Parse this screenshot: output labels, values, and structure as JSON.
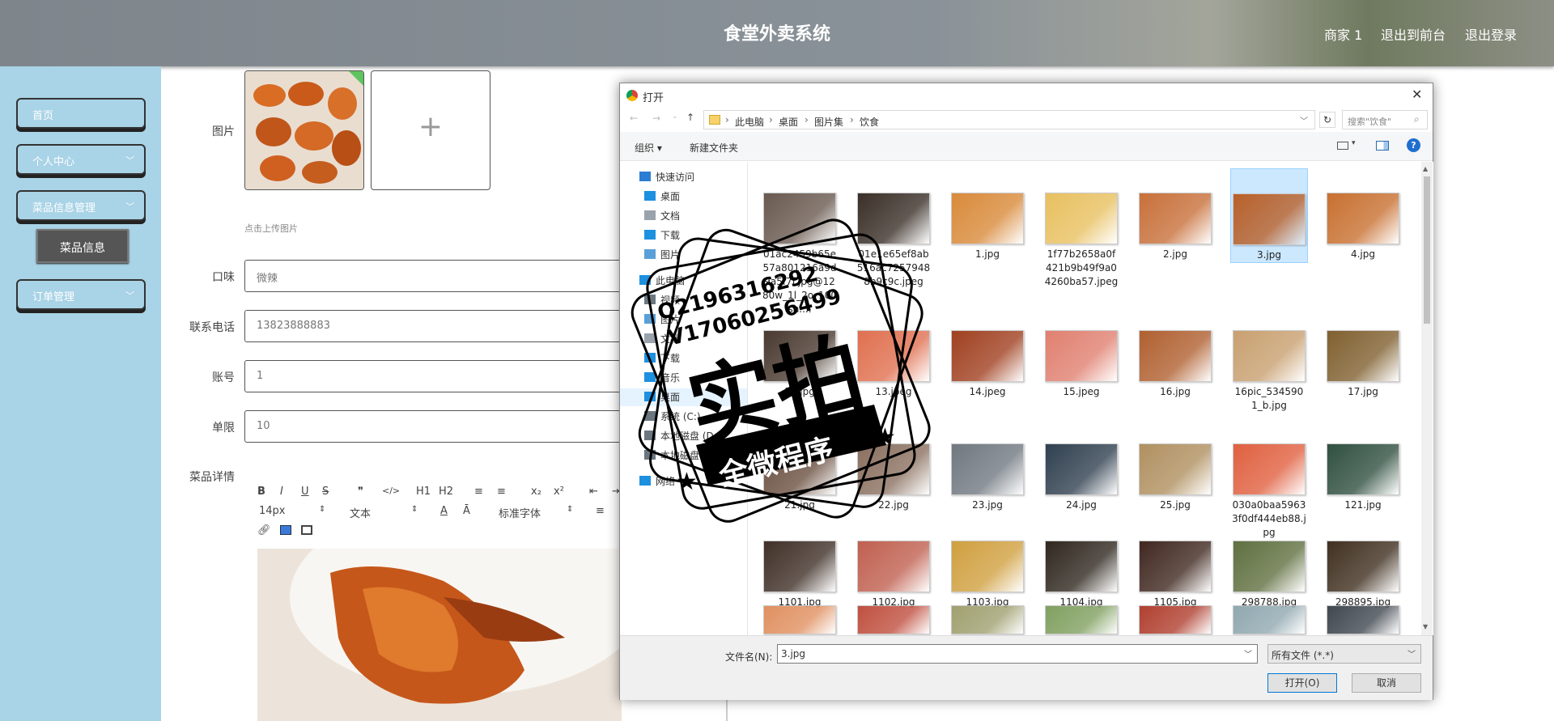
{
  "header": {
    "title": "食堂外卖系统",
    "nav": [
      "商家 1",
      "退出到前台",
      "退出登录"
    ]
  },
  "sidebar": {
    "items": [
      {
        "label": "首页"
      },
      {
        "label": "个人中心"
      },
      {
        "label": "菜品信息管理"
      },
      {
        "label": "订单管理"
      }
    ],
    "submenu": "菜品信息"
  },
  "form": {
    "image_label": "图片",
    "upload_hint": "点击上传图片",
    "plus": "+",
    "fields": [
      {
        "label": "口味",
        "value": "微辣"
      },
      {
        "label": "联系电话",
        "value": "13823888883"
      },
      {
        "label": "账号",
        "value": "1"
      },
      {
        "label": "单限",
        "value": "10"
      }
    ],
    "detail_label": "菜品详情",
    "editor": {
      "row1": [
        "B",
        "I",
        "U",
        "S",
        "❞",
        "</>",
        "H1",
        "H2",
        "≡",
        "≡",
        "x₂",
        "x²",
        "⇤",
        "⇥"
      ],
      "size": "14px",
      "kind": "文本",
      "font": "标准字体"
    }
  },
  "dialog": {
    "title": "打开",
    "close": "✕",
    "path": [
      "此电脑",
      "桌面",
      "图片集",
      "饮食"
    ],
    "search_placeholder": "搜索\"饮食\"",
    "organize": "组织 ▾",
    "new_folder": "新建文件夹",
    "help": "?",
    "nav": [
      {
        "label": "快速访问",
        "icon": "star-icon",
        "color": "#2b7cd3"
      },
      {
        "label": "桌面",
        "icon": "desktop-icon",
        "color": "#1e90e0"
      },
      {
        "label": "文档",
        "icon": "document-icon",
        "color": "#9aa3ab"
      },
      {
        "label": "下载",
        "icon": "download-icon",
        "color": "#1e90e0"
      },
      {
        "label": "图片",
        "icon": "pictures-icon",
        "color": "#5aa0d8"
      },
      {
        "label": "此电脑",
        "icon": "computer-icon",
        "color": "#1e90e0"
      },
      {
        "label": "视频",
        "icon": "video-icon",
        "color": "#6b7680"
      },
      {
        "label": "图片",
        "icon": "pictures-icon",
        "color": "#5aa0d8"
      },
      {
        "label": "文档",
        "icon": "document-icon",
        "color": "#9aa3ab"
      },
      {
        "label": "下载",
        "icon": "download-icon",
        "color": "#1e90e0"
      },
      {
        "label": "音乐",
        "icon": "music-icon",
        "color": "#1e90e0"
      },
      {
        "label": "桌面",
        "icon": "desktop-icon",
        "color": "#1e90e0"
      },
      {
        "label": "系统 (C:)",
        "icon": "drive-icon",
        "color": "#6b7680"
      },
      {
        "label": "本地磁盘 (D:)",
        "icon": "drive-icon",
        "color": "#6b7680"
      },
      {
        "label": "本地磁盘 (E:)",
        "icon": "drive-icon",
        "color": "#6b7680"
      },
      {
        "label": "网络",
        "icon": "network-icon",
        "color": "#1e90e0"
      }
    ],
    "files": [
      {
        "name": "01ac2459b65e57a801216a9d9a5f7f.jpg@1280w_1l_2o_100sh....",
        "color": "#6a5a50"
      },
      {
        "name": "01e1e65ef8ab516ac72579488b9c9c.jpeg",
        "color": "#3a2f28"
      },
      {
        "name": "1.jpg",
        "color": "#d98a3a"
      },
      {
        "name": "1f77b2658a0f421b9b49f9a04260ba57.jpeg",
        "color": "#e8c060"
      },
      {
        "name": "2.jpg",
        "color": "#c8703a"
      },
      {
        "name": "3.jpg",
        "color": "#b8602a"
      },
      {
        "name": "4.jpg",
        "color": "#c87030"
      },
      {
        "name": "12.jpg",
        "color": "#4a3a30"
      },
      {
        "name": "13.jpeg",
        "color": "#e07050"
      },
      {
        "name": "14.jpeg",
        "color": "#a04020"
      },
      {
        "name": "15.jpeg",
        "color": "#e08070"
      },
      {
        "name": "16.jpg",
        "color": "#b06030"
      },
      {
        "name": "16pic_5345901_b.jpg",
        "color": "#c8a070"
      },
      {
        "name": "17.jpg",
        "color": "#806030"
      },
      {
        "name": "21.jpg",
        "color": "#6a5040"
      },
      {
        "name": "22.jpg",
        "color": "#8a7060"
      },
      {
        "name": "23.jpg",
        "color": "#707880"
      },
      {
        "name": "24.jpg",
        "color": "#304050"
      },
      {
        "name": "25.jpg",
        "color": "#b09060"
      },
      {
        "name": "030a0baa59633f0df444eb88.jpg",
        "color": "#e06040"
      },
      {
        "name": "121.jpg",
        "color": "#305040"
      },
      {
        "name": "1101.jpg",
        "color": "#403028"
      },
      {
        "name": "1102.jpg",
        "color": "#c06050"
      },
      {
        "name": "1103.jpg",
        "color": "#d0a040"
      },
      {
        "name": "1104.jpg",
        "color": "#302820"
      },
      {
        "name": "1105.jpg",
        "color": "#402820"
      },
      {
        "name": "298788.jpg",
        "color": "#607040"
      },
      {
        "name": "298895.jpg",
        "color": "#403020"
      },
      {
        "name": "",
        "color": "#e09060"
      },
      {
        "name": "",
        "color": "#c05040"
      },
      {
        "name": "",
        "color": "#a0a070"
      },
      {
        "name": "",
        "color": "#80a060"
      },
      {
        "name": "",
        "color": "#b04030"
      },
      {
        "name": "",
        "color": "#90a8b0"
      },
      {
        "name": "",
        "color": "#404850"
      }
    ],
    "filename_label": "文件名(N):",
    "filename_value": "3.jpg",
    "filetype": "所有文件 (*.*)",
    "open_button": "打开(O)",
    "cancel_button": "取消"
  },
  "watermark": {
    "line1": "Q2196316292",
    "line2": "V17060256499",
    "main": "实拍",
    "banner": "全微程序"
  }
}
